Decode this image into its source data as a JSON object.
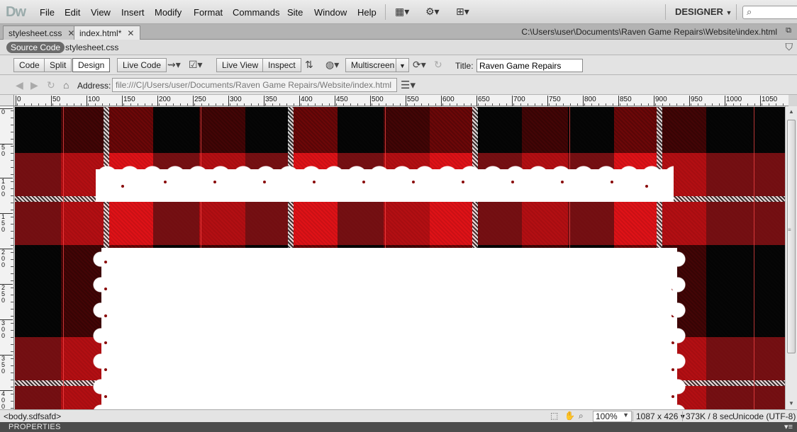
{
  "app": {
    "logo": "Dw",
    "workspace": "DESIGNER",
    "workspace_caret": "▼",
    "search_icon": "⌕"
  },
  "menu": [
    "File",
    "Edit",
    "View",
    "Insert",
    "Modify",
    "Format",
    "Commands",
    "Site",
    "Window",
    "Help"
  ],
  "tabs": [
    {
      "label": "stylesheet.css",
      "close": "✕"
    },
    {
      "label": "index.html*",
      "close": "✕"
    }
  ],
  "document_path": "C:\\Users\\user\\Documents\\Raven Game Repairs\\Website\\index.html",
  "related_files": {
    "source": "Source Code",
    "file": "stylesheet.css"
  },
  "view_buttons": {
    "code": "Code",
    "split": "Split",
    "design": "Design"
  },
  "live_code": "Live Code",
  "live_view": "Live View",
  "inspect": "Inspect",
  "multiscreen": "Multiscreen",
  "title_label": "Title:",
  "title_value": "Raven Game Repairs",
  "address_label": "Address:",
  "address_value": "file:///C|/Users/user/Documents/Raven Game Repairs/Website/index.html",
  "ruler": {
    "h_ticks": [
      "0",
      "50",
      "100",
      "150",
      "200",
      "250",
      "300",
      "350",
      "400",
      "450",
      "500",
      "550",
      "600",
      "650",
      "700",
      "750",
      "800",
      "850",
      "900",
      "950",
      "1000",
      "1050"
    ],
    "v_ticks": [
      "0",
      "50",
      "100",
      "150",
      "200",
      "250",
      "300",
      "350",
      "400"
    ]
  },
  "status": {
    "tag": "<body.sdfsafd>",
    "zoom": "100%",
    "dimensions": "1087 x 426",
    "dimensions_caret": "▾",
    "size_time": "373K / 8 sec",
    "encoding": "Unicode (UTF-8)"
  },
  "properties_panel": {
    "title": "PROPERTIES"
  },
  "colors": {
    "plaid_red": "#c60d10",
    "plaid_black": "#0b0b0b",
    "lace": "#ffffff"
  }
}
